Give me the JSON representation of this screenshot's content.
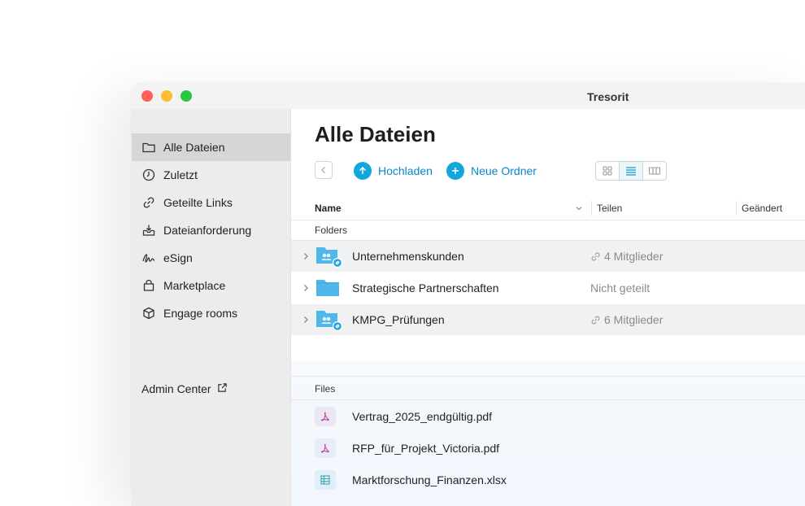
{
  "app": {
    "title": "Tresorit"
  },
  "sidebar": {
    "items": [
      {
        "label": "Alle Dateien",
        "icon": "folder-icon",
        "active": true
      },
      {
        "label": "Zuletzt",
        "icon": "clock-icon"
      },
      {
        "label": "Geteilte Links",
        "icon": "link-icon"
      },
      {
        "label": "Dateianforderung",
        "icon": "inbox-download-icon"
      },
      {
        "label": "eSign",
        "icon": "signature-icon"
      },
      {
        "label": "Marketplace",
        "icon": "shopping-bag-icon"
      },
      {
        "label": "Engage rooms",
        "icon": "cube-icon"
      }
    ],
    "admin_center": "Admin Center"
  },
  "main": {
    "title": "Alle Dateien",
    "upload_label": "Hochladen",
    "new_folder_label": "Neue Ordner",
    "columns": {
      "name": "Name",
      "share": "Teilen",
      "changed": "Geändert"
    },
    "folders_label": "Folders",
    "files_label": "Files",
    "folders": [
      {
        "name": "Unternehmenskunden",
        "share": "4 Mitglieder",
        "shared": true
      },
      {
        "name": "Strategische Partnerschaften",
        "share": "Nicht geteilt",
        "shared": false
      },
      {
        "name": "KMPG_Prüfungen",
        "share": "6 Mitglieder",
        "shared": true
      }
    ],
    "files": [
      {
        "name": "Vertrag_2025_endgültig.pdf",
        "type": "pdf"
      },
      {
        "name": "RFP_für_Projekt_Victoria.pdf",
        "type": "pdf"
      },
      {
        "name": "Marktforschung_Finanzen.xlsx",
        "type": "xlsx"
      }
    ]
  },
  "colors": {
    "accent": "#12a6dc",
    "accent_text": "#0a86c9",
    "folder": "#4fb7ea",
    "pdf": "#c8409a",
    "xlsx": "#3aa8a8"
  }
}
